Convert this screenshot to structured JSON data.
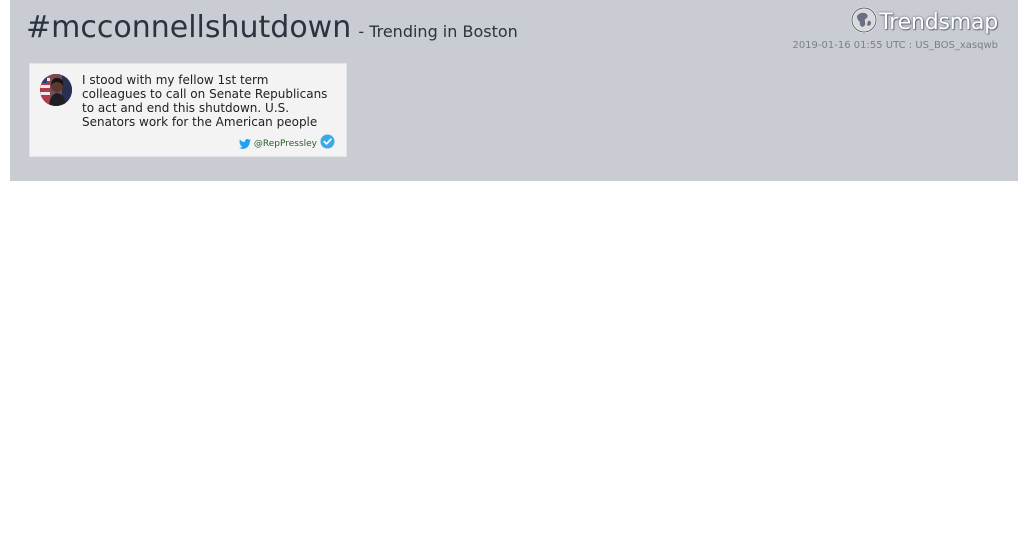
{
  "header": {
    "hashtag": "#mcconnellshutdown",
    "subtitle": "- Trending in Boston",
    "brand": "Trendsmap",
    "meta": "2019-01-16 01:55 UTC : US_BOS_xasqwb"
  },
  "tweet": {
    "text": "I stood with my fellow 1st term colleagues to call on Senate Republicans to act and end this shutdown. U.S. Senators work for the American people",
    "handle": "@RepPressley",
    "verified": true
  },
  "colors": {
    "panel": "#c9ccd3",
    "card": "#f3f3f4",
    "twitter": "#1da1f2",
    "verified": "#3aa9e8"
  },
  "icons": [
    "trendsmap-logo-icon",
    "avatar",
    "twitter-bird-icon",
    "verified-badge-icon"
  ]
}
